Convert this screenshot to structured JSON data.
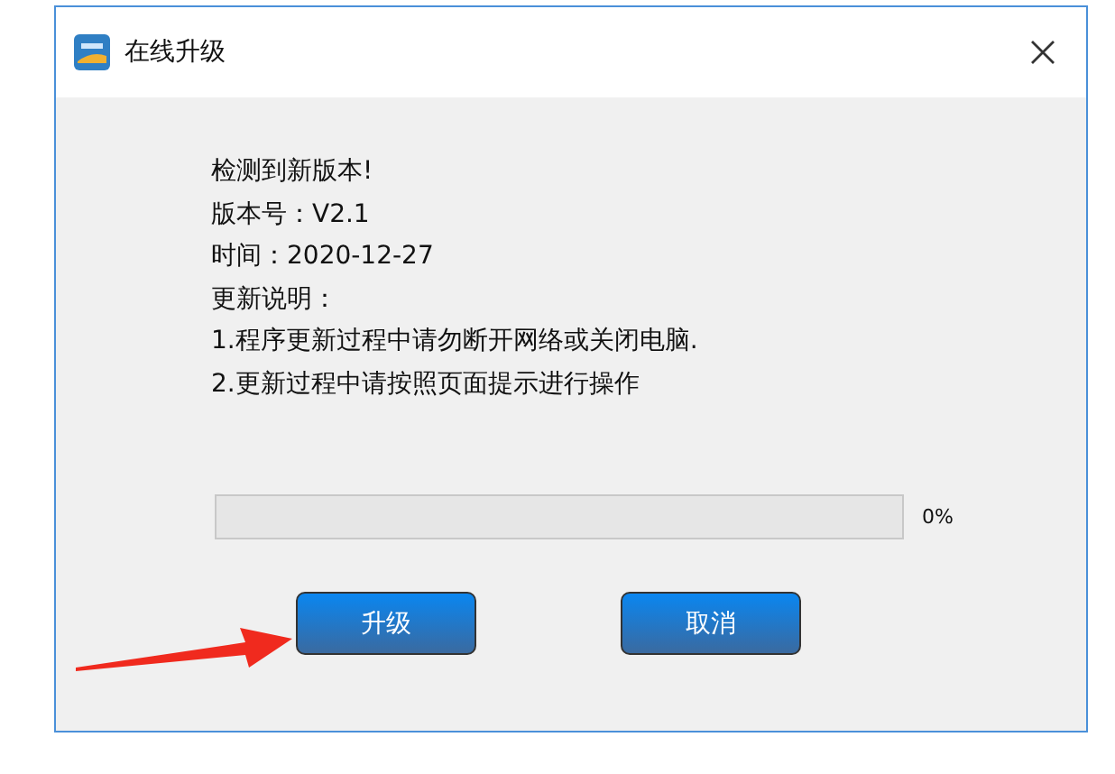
{
  "window": {
    "title": "在线升级"
  },
  "lines": [
    "检测到新版本!",
    "版本号：V2.1",
    "时间：2020-12-27",
    "更新说明：",
    "1.程序更新过程中请勿断开网络或关闭电脑.",
    "2.更新过程中请按照页面提示进行操作"
  ],
  "progress": {
    "level": 0,
    "reading": "0%"
  },
  "buttons": [
    {
      "label": "升级"
    },
    {
      "label": "取消"
    }
  ]
}
